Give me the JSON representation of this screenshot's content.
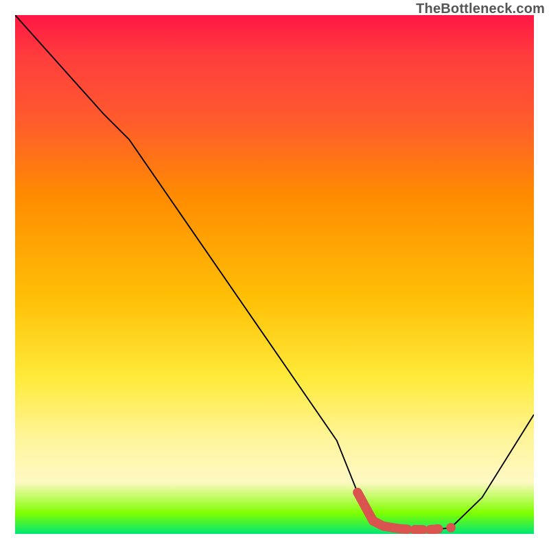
{
  "watermark": "TheBottleneck.com",
  "chart_data": {
    "type": "line",
    "title": "",
    "xlabel": "",
    "ylabel": "",
    "xlim": [
      0,
      100
    ],
    "ylim": [
      0,
      100
    ],
    "series": [
      {
        "name": "curve",
        "points": [
          {
            "x": 0,
            "y": 100
          },
          {
            "x": 17,
            "y": 81
          },
          {
            "x": 22,
            "y": 76
          },
          {
            "x": 62,
            "y": 18
          },
          {
            "x": 66,
            "y": 8
          },
          {
            "x": 70,
            "y": 2.5
          },
          {
            "x": 74,
            "y": 0.8
          },
          {
            "x": 80,
            "y": 0.7
          },
          {
            "x": 84,
            "y": 1.2
          },
          {
            "x": 90,
            "y": 7
          },
          {
            "x": 100,
            "y": 23
          }
        ],
        "stroke": "#000000",
        "stroke_width": 2,
        "fill": "none"
      }
    ],
    "highlight": {
      "name": "valley-highlight",
      "points": [
        {
          "x": 66,
          "y": 8
        },
        {
          "x": 69,
          "y": 2.5
        },
        {
          "x": 71,
          "y": 1.5
        },
        {
          "x": 74,
          "y": 1.0
        },
        {
          "x": 77,
          "y": 0.8
        },
        {
          "x": 80,
          "y": 0.8
        },
        {
          "x": 82,
          "y": 1.0
        }
      ],
      "stroke": "#d9534f",
      "stroke_width": 14,
      "dot_x": 84,
      "dot_y": 1.2,
      "dot_r": 7
    }
  }
}
